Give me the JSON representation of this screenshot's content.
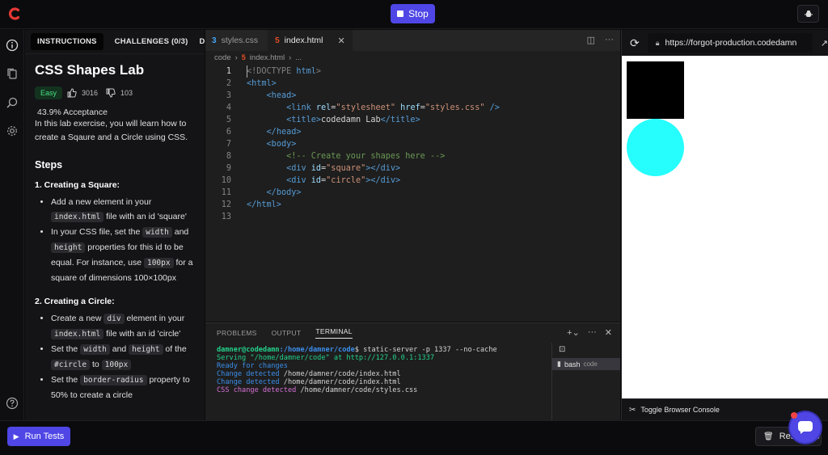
{
  "topbar": {
    "stop_label": "Stop",
    "brand_color": "#e53935",
    "accent": "#4f46e5"
  },
  "instructions": {
    "tabs": [
      {
        "label": "INSTRUCTIONS"
      },
      {
        "label": "CHALLENGES (0/3)"
      },
      {
        "label": "D"
      }
    ],
    "title": "CSS Shapes Lab",
    "difficulty": "Easy",
    "likes": "3016",
    "dislikes": "103",
    "acceptance": "43.9% Acceptance",
    "intro": "In this lab exercise, you will learn how to create a Sqaure and a Circle using CSS.",
    "steps_heading": "Steps",
    "step1": {
      "heading": "1. Creating a Square:",
      "b1": {
        "t1": "Add a new element in your ",
        "c1": "index.html",
        "t2": " file with an id 'square'"
      },
      "b2": {
        "t1": "In your CSS file, set the ",
        "c1": "width",
        "t2": " and ",
        "c2": "height",
        "t3": " properties for this id to be equal. For instance, use ",
        "c3": "100px",
        "t4": " for a square of dimensions 100×100px"
      }
    },
    "step2": {
      "heading": "2. Creating a Circle:",
      "b1": {
        "t1": "Create a new ",
        "c1": "div",
        "t2": " element in your ",
        "c2": "index.html",
        "t3": " file with an id 'circle'"
      },
      "b2": {
        "t1": "Set the ",
        "c1": "width",
        "t2": " and ",
        "c2": "height",
        "t3": " of the ",
        "c3": "#circle",
        "t4": " to ",
        "c4": "100px"
      },
      "b3": {
        "t1": "Set the ",
        "c1": "border-radius",
        "t2": " property to 50% to create a circle"
      }
    }
  },
  "editor": {
    "tabs": [
      {
        "label": "styles.css"
      },
      {
        "label": "index.html"
      }
    ],
    "breadcrumb": {
      "folder": "code",
      "file": "index.html",
      "more": "..."
    },
    "lines": {
      "l1": {
        "n": "1",
        "a": "<!DOCTYPE",
        "b": " html",
        "c": ">"
      },
      "l2": {
        "n": "2",
        "a": "<html>"
      },
      "l3": {
        "n": "3",
        "a": "<head>"
      },
      "l4": {
        "n": "4",
        "a": "<link",
        "b": " rel",
        "c": "=",
        "d": "\"stylesheet\"",
        "e": " href",
        "f": "=",
        "g": "\"styles.css\"",
        "h": " />"
      },
      "l5": {
        "n": "5",
        "a": "<title>",
        "b": "codedamn Lab",
        "c": "</title>"
      },
      "l6": {
        "n": "6",
        "a": "</head>"
      },
      "l7": {
        "n": "7",
        "a": "<body>"
      },
      "l8": {
        "n": "8",
        "a": "<!-- Create your shapes here -->"
      },
      "l9": {
        "n": "9",
        "a": "<div",
        "b": " id",
        "c": "=",
        "d": "\"square\"",
        "e": "></div>"
      },
      "l10": {
        "n": "10",
        "a": "<div",
        "b": " id",
        "c": "=",
        "d": "\"circle\"",
        "e": "></div>"
      },
      "l11": {
        "n": "11",
        "a": "</body>"
      },
      "l12": {
        "n": "12",
        "a": "</html>"
      },
      "l13": {
        "n": "13"
      }
    }
  },
  "terminal": {
    "tabs": [
      {
        "label": "PROBLEMS"
      },
      {
        "label": "OUTPUT"
      },
      {
        "label": "TERMINAL"
      }
    ],
    "prompt_user": "damner@codedamn",
    "prompt_path": ":/home/damner/code",
    "prompt_cmd": "$ static-server -p 1337 --no-cache",
    "out1_a": "Serving \"/home/damner/code\" at http://127.0.0.1:1337",
    "out2": "Ready for changes",
    "out3_a": "Change detected",
    "out3_b": " /home/damner/code/index.html",
    "out4_a": "Change detected",
    "out4_b": " /home/damner/code/index.html",
    "out5_a": "CSS change detected",
    "out5_b": " /home/damner/code/styles.css",
    "session_name": "bash",
    "session_dir": "code"
  },
  "preview": {
    "url": "https://forgot-production.codedamn",
    "square_color": "#000000",
    "circle_color": "#26fdfd",
    "console_label": "Toggle Browser Console"
  },
  "bottombar": {
    "run_label": "Run Tests",
    "reset_label": "Reset Lab"
  }
}
